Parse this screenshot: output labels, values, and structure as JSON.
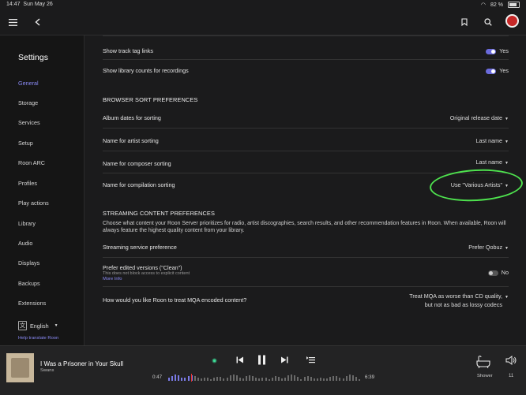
{
  "status": {
    "time": "14:47",
    "date": "Sun May 26",
    "battery": "82 %"
  },
  "sidebar": {
    "title": "Settings",
    "items": [
      {
        "label": "General",
        "active": true
      },
      {
        "label": "Storage"
      },
      {
        "label": "Services"
      },
      {
        "label": "Setup"
      },
      {
        "label": "Roon ARC"
      },
      {
        "label": "Profiles"
      },
      {
        "label": "Play actions"
      },
      {
        "label": "Library"
      },
      {
        "label": "Audio"
      },
      {
        "label": "Displays"
      },
      {
        "label": "Backups"
      },
      {
        "label": "Extensions"
      }
    ],
    "language": "English",
    "help": "Help translate Roon"
  },
  "settings": {
    "track_tag_links": {
      "label": "Show track tag links",
      "value": "Yes"
    },
    "library_counts": {
      "label": "Show library counts for recordings",
      "value": "Yes"
    },
    "browser_sort_header": "BROWSER SORT PREFERENCES",
    "album_dates": {
      "label": "Album dates for sorting",
      "value": "Original release date"
    },
    "artist_sort": {
      "label": "Name for artist sorting",
      "value": "Last name"
    },
    "composer_sort": {
      "label": "Name for composer sorting",
      "value": "Last name"
    },
    "compilation_sort": {
      "label": "Name for compilation sorting",
      "value": "Use \"Various Artists\""
    },
    "streaming_header": "STREAMING CONTENT PREFERENCES",
    "streaming_desc": "Choose what content your Roon Server prioritizes for radio, artist discographies, search results, and other recommendation features in Roon. When available, Roon will always feature the highest quality content from your library.",
    "streaming_service": {
      "label": "Streaming service preference",
      "value": "Prefer Qobuz"
    },
    "edited_versions": {
      "label": "Prefer edited versions (\"Clean\")",
      "sub": "This does not block access to explicit content",
      "more": "More Info",
      "value": "No"
    },
    "mqa": {
      "label": "How would you like Roon to treat MQA encoded content?",
      "value_line1": "Treat MQA as worse than CD quality,",
      "value_line2": "but not as bad as lossy codecs"
    }
  },
  "player": {
    "title": "I Was a Prisoner in Your Skull",
    "artist": "Swans",
    "elapsed": "0:47",
    "duration": "6:39",
    "progress": 0.118,
    "zone": "Shower",
    "volume": "11"
  },
  "colors": {
    "accent": "#8a8af5",
    "highlight": "#4ee24e"
  }
}
